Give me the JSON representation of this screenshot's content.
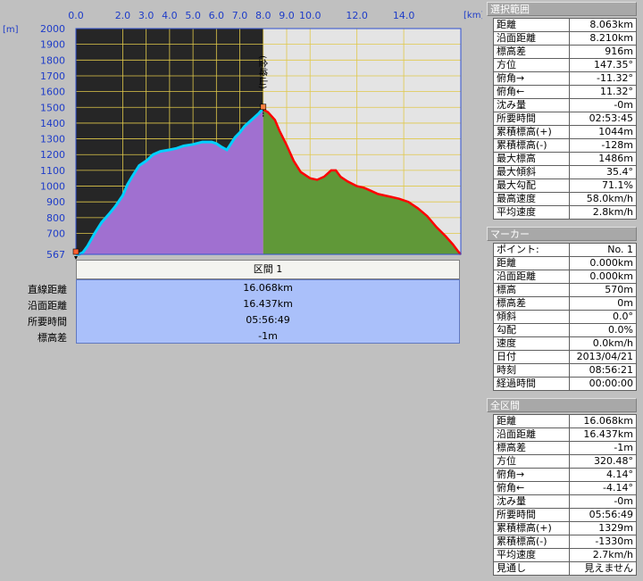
{
  "chart_data": {
    "type": "area",
    "x_unit": "[km]",
    "y_unit": "[m]",
    "x_ticks": [
      "0.0",
      "2.0",
      "3.0",
      "4.0",
      "5.0",
      "6.0",
      "7.0",
      "8.0",
      "9.0",
      "10.0",
      "12.0",
      "14.0"
    ],
    "y_ticks": [
      "2000",
      "1900",
      "1800",
      "1700",
      "1600",
      "1500",
      "1400",
      "1300",
      "1200",
      "1100",
      "1000",
      "900",
      "800",
      "700",
      "567"
    ],
    "xlim": [
      0,
      16.437
    ],
    "ylim": [
      567,
      2000
    ],
    "peak_label": "(金峰山)",
    "peak_x": 8.0,
    "selection_end_x": 8.0,
    "selected_profile": {
      "x": [
        0.0,
        0.15,
        0.3,
        0.5,
        0.8,
        1.1,
        1.4,
        1.7,
        2.0,
        2.2,
        2.4,
        2.7,
        3.0,
        3.3,
        3.6,
        4.0,
        4.3,
        4.6,
        5.0,
        5.4,
        5.8,
        6.0,
        6.2,
        6.45,
        6.6,
        6.8,
        7.0,
        7.2,
        7.5,
        7.8,
        7.95,
        8.0
      ],
      "y": [
        567,
        567,
        580,
        620,
        700,
        770,
        820,
        875,
        940,
        1010,
        1060,
        1130,
        1160,
        1200,
        1220,
        1230,
        1240,
        1255,
        1265,
        1280,
        1280,
        1270,
        1250,
        1230,
        1265,
        1310,
        1340,
        1380,
        1420,
        1460,
        1486,
        1486
      ]
    },
    "remaining_profile": {
      "x": [
        8.0,
        8.2,
        8.5,
        8.7,
        9.0,
        9.3,
        9.6,
        10.0,
        10.3,
        10.6,
        10.9,
        11.1,
        11.3,
        11.6,
        12.0,
        12.3,
        12.6,
        12.9,
        13.2,
        13.5,
        13.8,
        14.2,
        14.6,
        15.0,
        15.4,
        15.8,
        16.1,
        16.3,
        16.437
      ],
      "y": [
        1486,
        1470,
        1420,
        1350,
        1260,
        1160,
        1090,
        1050,
        1040,
        1060,
        1100,
        1100,
        1060,
        1030,
        1000,
        990,
        970,
        950,
        940,
        930,
        920,
        900,
        860,
        810,
        740,
        680,
        630,
        590,
        566
      ]
    },
    "colors": {
      "selected_fill": "#a070d0",
      "selected_line": "#00d0ff",
      "selected_bg": "#262626",
      "remaining_fill": "#609838",
      "remaining_line": "#ff0000",
      "remaining_bg": "#e4e4e4",
      "grid": "#e0c84a",
      "axis_text": "#1e3cc8",
      "frame": "#3050d0"
    }
  },
  "interval": {
    "header": "区間 1",
    "rows": [
      {
        "label": "直線距離",
        "value": "16.068km"
      },
      {
        "label": "沿面距離",
        "value": "16.437km"
      },
      {
        "label": "所要時間",
        "value": "05:56:49"
      },
      {
        "label": "標高差",
        "value": "-1m"
      }
    ]
  },
  "panels": [
    {
      "title": "選択範囲",
      "rows": [
        {
          "k": "距離",
          "v": "8.063km"
        },
        {
          "k": "沿面距離",
          "v": "8.210km"
        },
        {
          "k": "標高差",
          "v": "916m"
        },
        {
          "k": "方位",
          "v": "147.35°"
        },
        {
          "k": "俯角→",
          "v": "-11.32°"
        },
        {
          "k": "俯角←",
          "v": "11.32°"
        },
        {
          "k": "沈み量",
          "v": "-0m"
        },
        {
          "k": "所要時間",
          "v": "02:53:45"
        },
        {
          "k": "累積標高(+)",
          "v": "1044m"
        },
        {
          "k": "累積標高(-)",
          "v": "-128m"
        },
        {
          "k": "最大標高",
          "v": "1486m"
        },
        {
          "k": "最大傾斜",
          "v": "35.4°"
        },
        {
          "k": "最大勾配",
          "v": "71.1%"
        },
        {
          "k": "最高速度",
          "v": "58.0km/h"
        },
        {
          "k": "平均速度",
          "v": "2.8km/h"
        }
      ]
    },
    {
      "title": "マーカー",
      "rows": [
        {
          "k": "ポイント:",
          "v": "No. 1"
        },
        {
          "k": "距離",
          "v": "0.000km"
        },
        {
          "k": "沿面距離",
          "v": "0.000km"
        },
        {
          "k": "標高",
          "v": "570m"
        },
        {
          "k": "標高差",
          "v": "0m"
        },
        {
          "k": "傾斜",
          "v": "0.0°"
        },
        {
          "k": "勾配",
          "v": "0.0%"
        },
        {
          "k": "速度",
          "v": "0.0km/h"
        },
        {
          "k": "日付",
          "v": "2013/04/21"
        },
        {
          "k": "時刻",
          "v": "08:56:21"
        },
        {
          "k": "経過時間",
          "v": "00:00:00"
        }
      ]
    },
    {
      "title": "全区間",
      "rows": [
        {
          "k": "距離",
          "v": "16.068km"
        },
        {
          "k": "沿面距離",
          "v": "16.437km"
        },
        {
          "k": "標高差",
          "v": "-1m"
        },
        {
          "k": "方位",
          "v": "320.48°"
        },
        {
          "k": "俯角→",
          "v": "4.14°"
        },
        {
          "k": "俯角←",
          "v": "-4.14°"
        },
        {
          "k": "沈み量",
          "v": "-0m"
        },
        {
          "k": "所要時間",
          "v": "05:56:49"
        },
        {
          "k": "累積標高(+)",
          "v": "1329m"
        },
        {
          "k": "累積標高(-)",
          "v": "-1330m"
        },
        {
          "k": "平均速度",
          "v": "2.7km/h"
        },
        {
          "k": "見通し",
          "v": "見えません"
        }
      ]
    }
  ]
}
